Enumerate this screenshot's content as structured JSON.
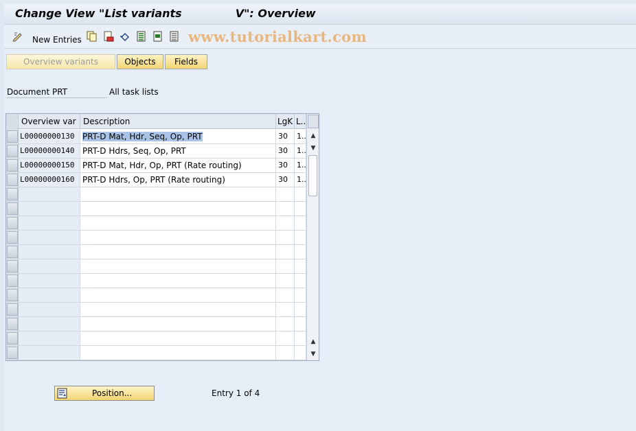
{
  "title": {
    "text": "Change View \"List variants              V\": Overview"
  },
  "toolbar": {
    "new_entries_label": "New Entries",
    "watermark": "www.tutorialkart.com",
    "icons": [
      "edit-pencil-icon",
      "copy-icon",
      "delete-icon",
      "undo-icon",
      "select-all-icon",
      "select-block-icon",
      "deselect-all-icon"
    ]
  },
  "tabs": {
    "overview_variants": "Overview variants",
    "objects": "Objects",
    "fields": "Fields"
  },
  "header_fields": {
    "label": "Document PRT",
    "value": "All task lists"
  },
  "table": {
    "columns": [
      "Overview var",
      "Description",
      "LgK",
      "L..."
    ],
    "rows": [
      {
        "var": "L00000000130",
        "desc": "PRT-D Mat, Hdr, Seq, Op, PRT",
        "lgk": "30",
        "l": "1..."
      },
      {
        "var": "L00000000140",
        "desc": "PRT-D Hdrs, Seq, Op, PRT",
        "lgk": "30",
        "l": "1..."
      },
      {
        "var": "L00000000150",
        "desc": "PRT-D Mat, Hdr, Op, PRT (Rate routing)",
        "lgk": "30",
        "l": "1..."
      },
      {
        "var": "L00000000160",
        "desc": "PRT-D Hdrs, Op, PRT (Rate routing)",
        "lgk": "30",
        "l": "1..."
      }
    ]
  },
  "footer": {
    "position_button": "Position...",
    "entry_info": "Entry 1 of 4"
  }
}
